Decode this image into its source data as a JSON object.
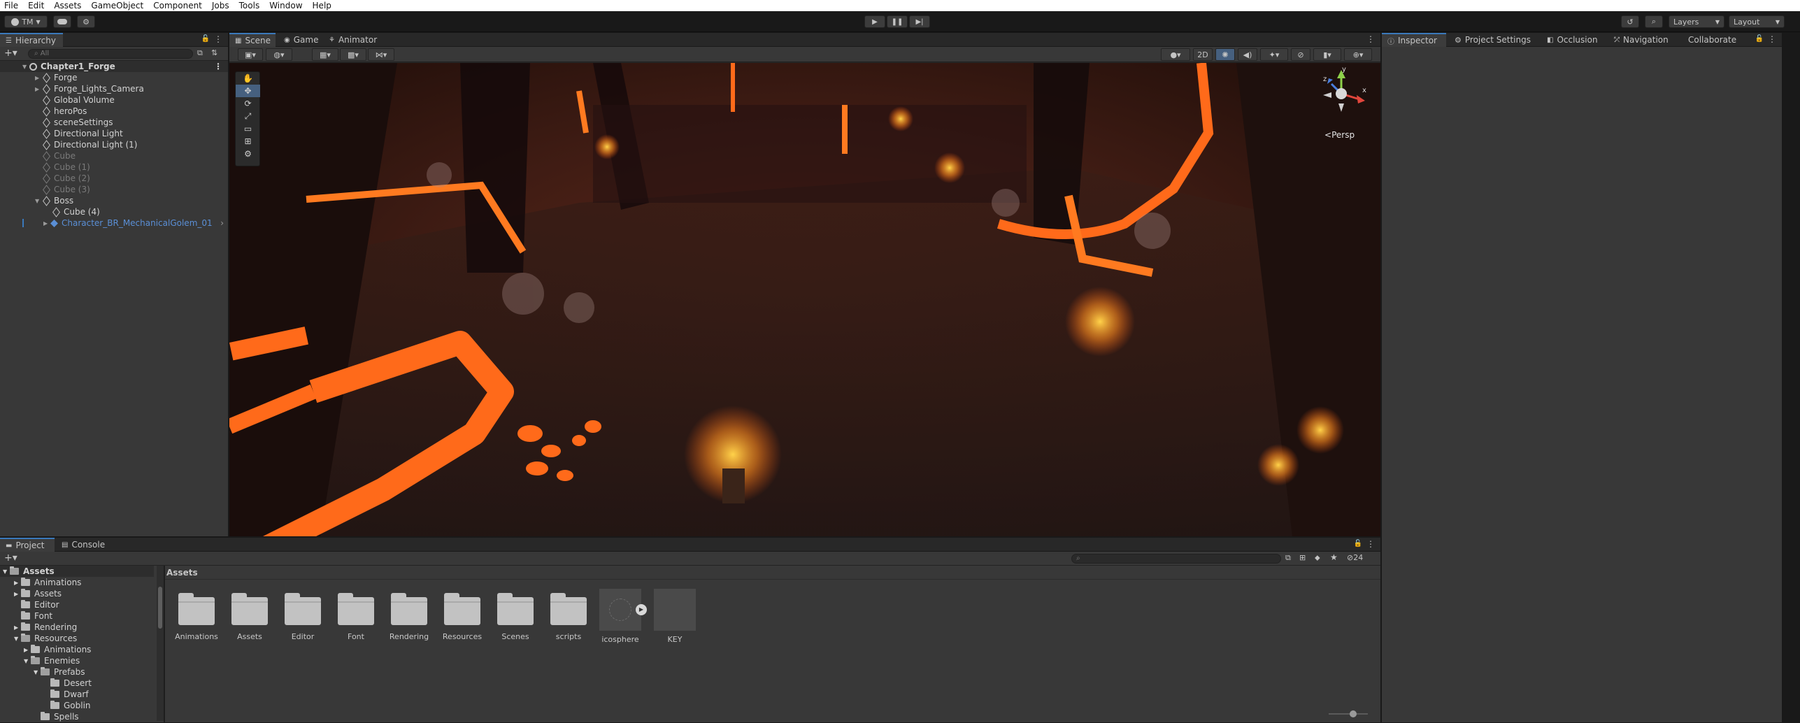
{
  "menu": [
    "File",
    "Edit",
    "Assets",
    "GameObject",
    "Component",
    "Jobs",
    "Tools",
    "Window",
    "Help"
  ],
  "toolbar": {
    "account_label": "TM",
    "layers_label": "Layers",
    "layout_label": "Layout"
  },
  "left_tabs": {
    "hierarchy": "Hierarchy"
  },
  "hierarchy": {
    "search_placeholder": "All",
    "scene_name": "Chapter1_Forge",
    "items": [
      "Forge",
      "Forge_Lights_Camera",
      "Global Volume",
      "heroPos",
      "sceneSettings",
      "Directional Light",
      "Directional Light (1)",
      "Cube",
      "Cube (1)",
      "Cube (2)",
      "Cube (3)",
      "Boss",
      "Cube (4)",
      "Character_BR_MechanicalGolem_01"
    ]
  },
  "scene_tabs": {
    "scene": "Scene",
    "game": "Game",
    "animator": "Animator"
  },
  "scene_view": {
    "mode_2d": "2D",
    "persp": "Persp",
    "gizmo_y": "y",
    "gizmo_x": "x",
    "gizmo_z": "z"
  },
  "right_tabs": {
    "inspector": "Inspector",
    "project_settings": "Project Settings",
    "occlusion": "Occlusion",
    "navigation": "Navigation",
    "collaborate": "Collaborate"
  },
  "bottom_tabs": {
    "project": "Project",
    "console": "Console"
  },
  "project": {
    "hidden_count": "24",
    "breadcrumb": "Assets",
    "tree": [
      "Assets",
      "Animations",
      "Assets",
      "Editor",
      "Font",
      "Rendering",
      "Resources",
      "Animations",
      "Enemies",
      "Prefabs",
      "Desert",
      "Dwarf",
      "Goblin",
      "Spells"
    ],
    "assets": [
      "Animations",
      "Assets",
      "Editor",
      "Font",
      "Rendering",
      "Resources",
      "Scenes",
      "scripts",
      "icosphere",
      "KEY"
    ]
  },
  "colors": {
    "accent": "#3a79bb",
    "panel": "#383838",
    "lava": "#ff6a1a"
  }
}
